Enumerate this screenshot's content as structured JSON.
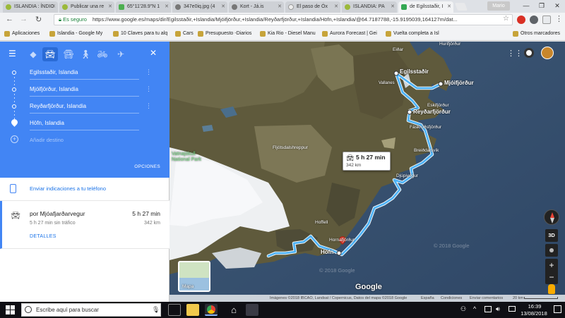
{
  "browser": {
    "tabs": [
      {
        "title": "ISLANDIA : ÍNDIC",
        "active": false
      },
      {
        "title": "Publicar una re",
        "active": false
      },
      {
        "title": "65°11'28.9\"N 1",
        "active": false
      },
      {
        "title": "347e0iq.jpg (4",
        "active": false
      },
      {
        "title": "Kort - Já.is",
        "active": false
      },
      {
        "title": "El paso de Óx",
        "active": false
      },
      {
        "title": "ISLANDIA: PA",
        "active": false
      },
      {
        "title": "de Egilsstaðir, I",
        "active": true
      }
    ],
    "profile_label": "Mario",
    "secure_label": "Es seguro",
    "url": "https://www.google.es/maps/dir/Egilsstaðir,+Islandia/Mjóifjörður,+Islandia/Reyðarfjörður,+Islandia/Höfn,+Islandia/@64.7187788,-15.9195039,164127m/dat...",
    "bookmarks": [
      "Aplicaciones",
      "Islandia - Google My",
      "10 Claves para tu alq",
      "Cars",
      "Presupuesto -Diarios",
      "Kia Rio - Diesel Manu",
      "Aurora Forecast | Gei",
      "Vuelta completa a Isl"
    ],
    "other_bookmarks": "Otros marcadores"
  },
  "directions": {
    "waypoints": [
      "Egilsstaðir, Islandia",
      "Mjóifjörður, Islandia",
      "Reyðarfjörður, Islandia",
      "Höfn, Islandia"
    ],
    "add_destination": "Añadir destino",
    "options_label": "OPCIONES",
    "send_to_phone": "Enviar indicaciones a tu teléfono",
    "route": {
      "via": "por Mjóafjarðarvegur",
      "duration": "5 h 27 min",
      "subtitle": "5 h 27 min sin tráfico",
      "distance": "342 km",
      "details_label": "DETALLES"
    }
  },
  "map": {
    "route_color": "#4fb3f6",
    "callout": {
      "duration": "5 h 27 min",
      "distance": "342 km"
    },
    "places": {
      "egilsstadir": "Egilsstaðir",
      "mjoifjordur": "Mjóifjörður",
      "reydarfjordur": "Reyðarfjörður",
      "hofn": "Höfn",
      "eidar": "Eiðar",
      "hurifjordur": "Hurifjörður",
      "vallanes": "Vallanes",
      "eskifjordur": "Eskifjörður",
      "faskrudsfjordur": "Fáskrúðsfjörður",
      "breiddalsvik": "Breiðdalsvík",
      "djupivogur": "Djúpivogur",
      "fljotsdalshreppur": "Fljótsdalshreppur",
      "vatnajokull": "Vatnajökull National Park",
      "hoffell": "Hoffell",
      "hornafjordur": "Hornafjörður"
    },
    "watermark_1": "© 2018 Google",
    "watermark_2": "© 2018 Google",
    "google_logo": "Google",
    "layer_label": "Mapa",
    "footer": {
      "credits": "Imágenes ©2018 IBCAO, Landsat / Copernicus, Datos del mapa ©2018 Google",
      "country": "España",
      "terms": "Condiciones",
      "feedback": "Enviar comentarios",
      "scale": "20 km"
    },
    "btn_3d": "3D"
  },
  "taskbar": {
    "search_placeholder": "Escribe aquí para buscar",
    "time": "16:39",
    "date": "13/08/2018"
  }
}
